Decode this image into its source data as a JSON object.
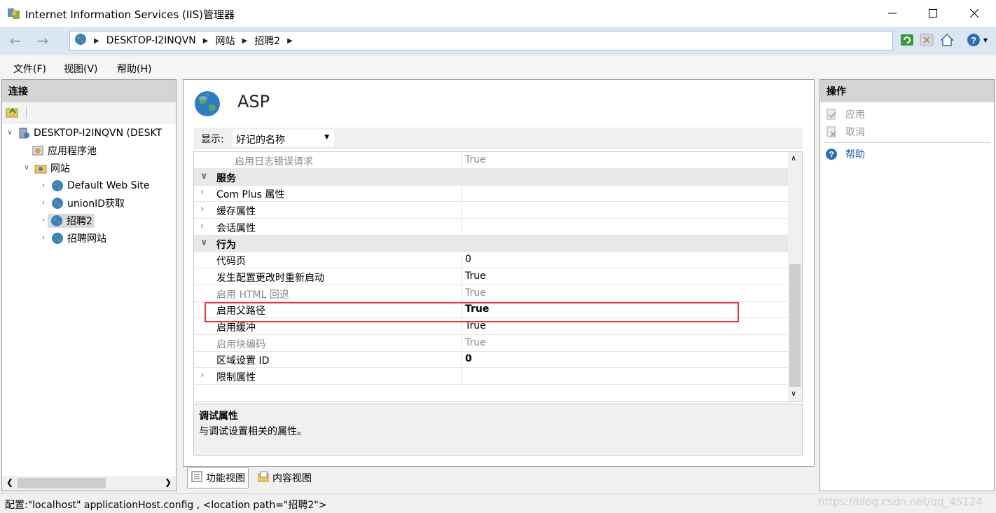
{
  "window": {
    "title": "Internet Information Services (IIS)管理器",
    "minimize_icon": "minimize-icon",
    "maximize_icon": "maximize-icon",
    "close_icon": "close-icon"
  },
  "address": {
    "crumbs": [
      "DESKTOP-I2INQVN",
      "网站",
      "招聘2"
    ]
  },
  "menu": {
    "file": "文件(F)",
    "view": "视图(V)",
    "help": "帮助(H)"
  },
  "connections": {
    "header": "连接",
    "tree": {
      "server": "DESKTOP-I2INQVN (DESKT",
      "app_pools": "应用程序池",
      "sites": "网站",
      "site_items": [
        "Default Web Site",
        "unionID获取",
        "招聘2",
        "招聘网站"
      ]
    }
  },
  "feature": {
    "title": "ASP",
    "show_label": "显示:",
    "show_value": "好记的名称",
    "rows": [
      {
        "name": "启用日志错误请求",
        "value": "True",
        "kind": "dim-child"
      },
      {
        "name": "服务",
        "value": "",
        "kind": "category"
      },
      {
        "name": "Com Plus 属性",
        "value": "",
        "kind": "group"
      },
      {
        "name": "缓存属性",
        "value": "",
        "kind": "group"
      },
      {
        "name": "会话属性",
        "value": "",
        "kind": "group"
      },
      {
        "name": "行为",
        "value": "",
        "kind": "category"
      },
      {
        "name": "代码页",
        "value": "0",
        "kind": "normal"
      },
      {
        "name": "发生配置更改时重新启动",
        "value": "True",
        "kind": "normal"
      },
      {
        "name": "启用 HTML 回退",
        "value": "True",
        "kind": "dim"
      },
      {
        "name": "启用父路径",
        "value": "True",
        "kind": "bold"
      },
      {
        "name": "启用缓冲",
        "value": "True",
        "kind": "normal"
      },
      {
        "name": "启用块编码",
        "value": "True",
        "kind": "dim"
      },
      {
        "name": "区域设置 ID",
        "value": "0",
        "kind": "bold"
      },
      {
        "name": "限制属性",
        "value": "",
        "kind": "group"
      }
    ],
    "description_title": "调试属性",
    "description_text": "与调试设置相关的属性。"
  },
  "view_tabs": {
    "features": "功能视图",
    "content": "内容视图"
  },
  "actions": {
    "header": "操作",
    "apply": "应用",
    "cancel": "取消",
    "help": "帮助"
  },
  "status": {
    "text": "配置:\"localhost\" applicationHost.config , <location path=\"招聘2\">",
    "watermark": "https://blog.csdn.net/qq_45124"
  },
  "colors": {
    "accent": "#1f5fa8",
    "highlight_border": "#e0393e",
    "address_bar": "#dbe6f3"
  }
}
